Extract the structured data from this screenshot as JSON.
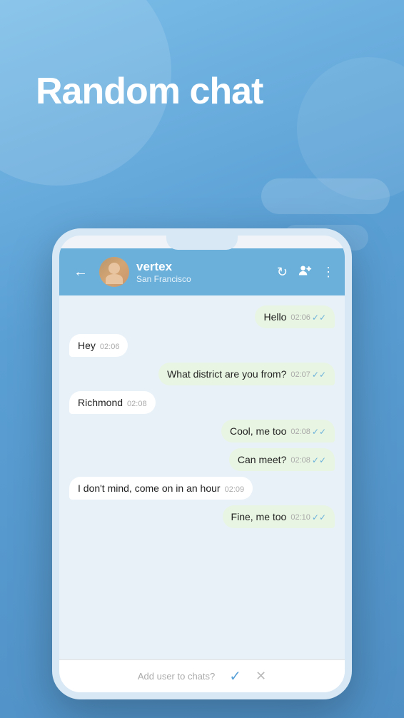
{
  "app": {
    "title": "Random chat",
    "background_color": "#5ba3d9"
  },
  "header": {
    "back_label": "←",
    "user_name": "vertex",
    "user_location": "San Francisco",
    "actions": {
      "refresh_icon": "↻",
      "add_user_icon": "👤+",
      "more_icon": "⋮"
    }
  },
  "messages": [
    {
      "id": 1,
      "text": "Hello",
      "time": "02:06",
      "type": "sent",
      "read": true
    },
    {
      "id": 2,
      "text": "Hey",
      "time": "02:06",
      "type": "received",
      "read": false
    },
    {
      "id": 3,
      "text": "What district are you from?",
      "time": "02:07",
      "type": "sent",
      "read": true
    },
    {
      "id": 4,
      "text": "Richmond",
      "time": "02:08",
      "type": "received",
      "read": false
    },
    {
      "id": 5,
      "text": "Cool, me too",
      "time": "02:08",
      "type": "sent",
      "read": true
    },
    {
      "id": 6,
      "text": "Can meet?",
      "time": "02:08",
      "type": "sent",
      "read": true
    },
    {
      "id": 7,
      "text": "I don't mind, come on in an hour",
      "time": "02:09",
      "type": "received",
      "read": false
    },
    {
      "id": 8,
      "text": "Fine, me too",
      "time": "02:10",
      "type": "sent",
      "read": true
    }
  ],
  "footer": {
    "prompt": "Add user to chats?",
    "confirm_icon": "✓",
    "cancel_icon": "✕"
  }
}
